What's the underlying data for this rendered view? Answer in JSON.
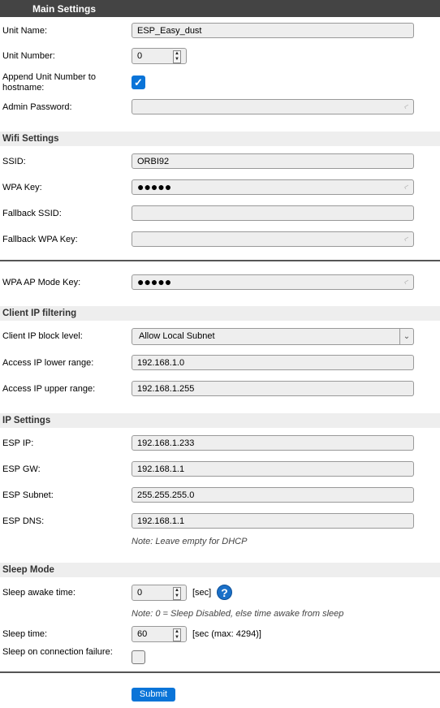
{
  "header": {
    "title": "Main Settings"
  },
  "rows": [
    {
      "type": "text",
      "label": "Unit Name:",
      "value": "ESP_Easy_dust"
    },
    {
      "type": "number",
      "label": "Unit Number:",
      "value": "0"
    },
    {
      "type": "checkbox",
      "label": "Append Unit Number to hostname:",
      "checked": true
    },
    {
      "type": "password",
      "label": "Admin Password:",
      "value": ""
    },
    {
      "type": "section",
      "label": "Wifi Settings"
    },
    {
      "type": "text",
      "label": "SSID:",
      "value": "ORBI92"
    },
    {
      "type": "password",
      "label": "WPA Key:",
      "value": "●●●●●"
    },
    {
      "type": "text",
      "label": "Fallback SSID:",
      "value": ""
    },
    {
      "type": "password",
      "label": "Fallback WPA Key:",
      "value": ""
    },
    {
      "type": "divider"
    },
    {
      "type": "password",
      "label": "WPA AP Mode Key:",
      "value": "●●●●●"
    },
    {
      "type": "section",
      "label": "Client IP filtering"
    },
    {
      "type": "select",
      "label": "Client IP block level:",
      "value": "Allow Local Subnet"
    },
    {
      "type": "text",
      "label": "Access IP lower range:",
      "value": "192.168.1.0"
    },
    {
      "type": "text",
      "label": "Access IP upper range:",
      "value": "192.168.1.255"
    },
    {
      "type": "section",
      "label": "IP Settings"
    },
    {
      "type": "text",
      "label": "ESP IP:",
      "value": "192.168.1.233"
    },
    {
      "type": "text",
      "label": "ESP GW:",
      "value": "192.168.1.1"
    },
    {
      "type": "text",
      "label": "ESP Subnet:",
      "value": "255.255.255.0"
    },
    {
      "type": "text",
      "label": "ESP DNS:",
      "value": "192.168.1.1"
    },
    {
      "type": "note",
      "label": "Note: Leave empty for DHCP"
    },
    {
      "type": "section",
      "label": "Sleep Mode"
    },
    {
      "type": "number",
      "label": "Sleep awake time:",
      "value": "0",
      "unit": "[sec]",
      "help": "?"
    },
    {
      "type": "note",
      "label": "Note: 0 = Sleep Disabled, else time awake from sleep"
    },
    {
      "type": "number",
      "label": "Sleep time:",
      "value": "60",
      "unit": "[sec (max: 4294)]"
    },
    {
      "type": "checkbox",
      "label": "Sleep on connection failure:",
      "checked": false
    },
    {
      "type": "divider"
    },
    {
      "type": "submit",
      "label": "Submit"
    }
  ],
  "colors": {
    "accent": "#0a74d8",
    "header": "#444444",
    "section": "#eeeeee"
  },
  "icons": {
    "password": "key-icon",
    "select": "chevron-down-icon",
    "help": "help-icon",
    "spinner": "spinner-arrows-icon",
    "checkbox": "checkmark-icon"
  }
}
